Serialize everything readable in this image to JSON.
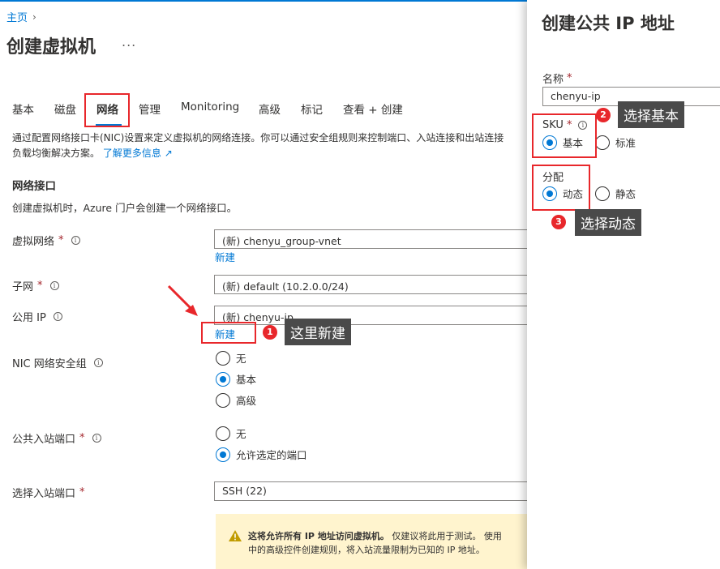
{
  "breadcrumb": {
    "home": "主页"
  },
  "page": {
    "title": "创建虚拟机",
    "more": "..."
  },
  "tabs": [
    {
      "label": "基本"
    },
    {
      "label": "磁盘"
    },
    {
      "label": "网络"
    },
    {
      "label": "管理"
    },
    {
      "label": "Monitoring"
    },
    {
      "label": "高级"
    },
    {
      "label": "标记"
    },
    {
      "label": "查看 + 创建"
    }
  ],
  "description": {
    "line1": "通过配置网络接口卡(NIC)设置来定义虚拟机的网络连接。你可以通过安全组规则来控制端口、入站连接和出站连接",
    "line2": "负载均衡解决方案。",
    "learn_more": "了解更多信息",
    "external_icon": "↗"
  },
  "nic_section": {
    "title": "网络接口",
    "desc": "创建虚拟机时，Azure 门户会创建一个网络接口。"
  },
  "fields": {
    "vnet": {
      "label": "虚拟网络",
      "required": "*",
      "value": "(新) chenyu_group-vnet",
      "new_link": "新建"
    },
    "subnet": {
      "label": "子网",
      "required": "*",
      "value": "(新) default (10.2.0.0/24)"
    },
    "public_ip": {
      "label": "公用 IP",
      "value": "(新) chenyu-ip",
      "new_link": "新建"
    },
    "nic_nsg": {
      "label": "NIC 网络安全组",
      "options": [
        "无",
        "基本",
        "高级"
      ],
      "selected": "基本"
    },
    "inbound_ports": {
      "label": "公共入站端口",
      "required": "*",
      "options": [
        "无",
        "允许选定的端口"
      ],
      "selected": "允许选定的端口"
    },
    "select_ports": {
      "label": "选择入站端口",
      "required": "*",
      "value": "SSH (22)"
    }
  },
  "warning": {
    "bold": "这将允许所有 IP 地址访问虚拟机。",
    "text1": " 仅建议将此用于测试。 使用",
    "text2": "中的高级控件创建规则，将入站流量限制为已知的 IP 地址。"
  },
  "panel": {
    "title": "创建公共 IP 地址",
    "name_label": "名称",
    "name_required": "*",
    "name_value": "chenyu-ip",
    "sku_label": "SKU",
    "sku_required": "*",
    "sku_options": [
      "基本",
      "标准"
    ],
    "sku_selected": "基本",
    "assign_label": "分配",
    "assign_options": [
      "动态",
      "静态"
    ],
    "assign_selected": "动态"
  },
  "annotations": {
    "step1": {
      "num": "1",
      "text": "这里新建"
    },
    "step2": {
      "num": "2",
      "text": "选择基本"
    },
    "step3": {
      "num": "3",
      "text": "选择动态"
    }
  },
  "colors": {
    "accent": "#0078d4",
    "annotation_red": "#e8272b",
    "callout_bg": "#4a4a4a",
    "warning_bg": "#fff4ce"
  }
}
